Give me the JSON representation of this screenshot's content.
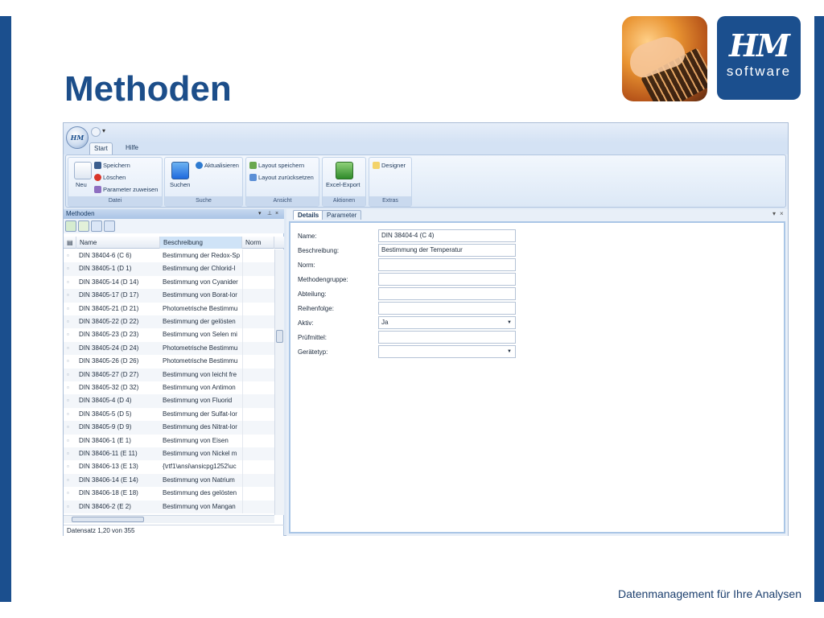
{
  "slide": {
    "title": "Methoden",
    "footer": "Datenmanagement für Ihre Analysen",
    "logo_mark": "HM",
    "logo_word": "software"
  },
  "app": {
    "orb_label": "HM",
    "tabs": [
      "Start",
      "Hilfe"
    ],
    "ribbon": {
      "datei": {
        "label": "Datei",
        "neu": "Neu",
        "speichern": "Speichern",
        "loeschen": "Löschen",
        "parameter_zuweisen": "Parameter zuweisen"
      },
      "suche": {
        "label": "Suche",
        "suchen": "Suchen",
        "aktualisieren": "Aktualisieren"
      },
      "ansicht": {
        "label": "Ansicht",
        "layout_speichern": "Layout speichern",
        "layout_zuruecksetzen": "Layout zurücksetzen"
      },
      "aktionen": {
        "label": "Aktionen",
        "excel_export": "Excel-Export"
      },
      "extras": {
        "label": "Extras",
        "designer": "Designer"
      }
    },
    "left_pane": {
      "title": "Methoden",
      "columns": [
        "Name",
        "Beschreibung",
        "Norm"
      ],
      "rows": [
        [
          "DIN 38404-6 (C 6)",
          "Bestimmung der Redox-Sp"
        ],
        [
          "DIN 38405-1 (D 1)",
          "Bestimmung der Chlorid-I"
        ],
        [
          "DIN 38405-14 (D 14)",
          "Bestimmung von Cyanider"
        ],
        [
          "DIN 38405-17 (D 17)",
          "Bestimmung von Borat-Ior"
        ],
        [
          "DIN 38405-21 (D 21)",
          "Photometrische Bestimmu"
        ],
        [
          "DIN 38405-22 (D 22)",
          "Bestimmung der gelösten"
        ],
        [
          "DIN 38405-23 (D 23)",
          "Bestimmung von Selen mi"
        ],
        [
          "DIN 38405-24 (D 24)",
          "Photometrische Bestimmu"
        ],
        [
          "DIN 38405-26 (D 26)",
          "Photometrische Bestimmu"
        ],
        [
          "DIN 38405-27 (D 27)",
          "Bestimmung von leicht fre"
        ],
        [
          "DIN 38405-32 (D 32)",
          "Bestimmung von Antimon"
        ],
        [
          "DIN 38405-4 (D 4)",
          "Bestimmung von Fluorid"
        ],
        [
          "DIN 38405-5 (D 5)",
          "Bestimmung der Sulfat-Ior"
        ],
        [
          "DIN 38405-9 (D 9)",
          "Bestimmung des Nitrat-Ior"
        ],
        [
          "DIN 38406-1 (E 1)",
          "Bestimmung von Eisen"
        ],
        [
          "DIN 38406-11 (E 11)",
          "Bestimmung von Nickel m"
        ],
        [
          "DIN 38406-13 (E 13)",
          "{\\rtf1\\ansi\\ansicpg1252\\uc"
        ],
        [
          "DIN 38406-14 (E 14)",
          "Bestimmung von Natrium"
        ],
        [
          "DIN 38406-18 (E 18)",
          "Bestimmung des gelösten"
        ],
        [
          "DIN 38406-2 (E 2)",
          "Bestimmung von Mangan"
        ]
      ],
      "status": "Datensatz 1,20 von 355"
    },
    "right_pane": {
      "tabs": [
        "Details",
        "Parameter"
      ],
      "fields": [
        {
          "label": "Name:",
          "value": ""
        },
        {
          "label": "Beschreibung:",
          "value": "Bestimmung der Temperatur"
        },
        {
          "label": "Norm:",
          "value": ""
        },
        {
          "label": "Methodengruppe:",
          "value": ""
        },
        {
          "label": "Abteilung:",
          "value": ""
        },
        {
          "label": "Reihenfolge:",
          "value": ""
        },
        {
          "label": "Aktiv:",
          "value": "Ja"
        },
        {
          "label": "Prüfmittel:",
          "value": ""
        },
        {
          "label": "Gerätetyp:",
          "value": ""
        }
      ],
      "name_value": "DIN 38404-4 (C 4)"
    }
  },
  "colors": {
    "brand_blue": "#1b4f8e",
    "title_blue": "#1c4e8a"
  }
}
